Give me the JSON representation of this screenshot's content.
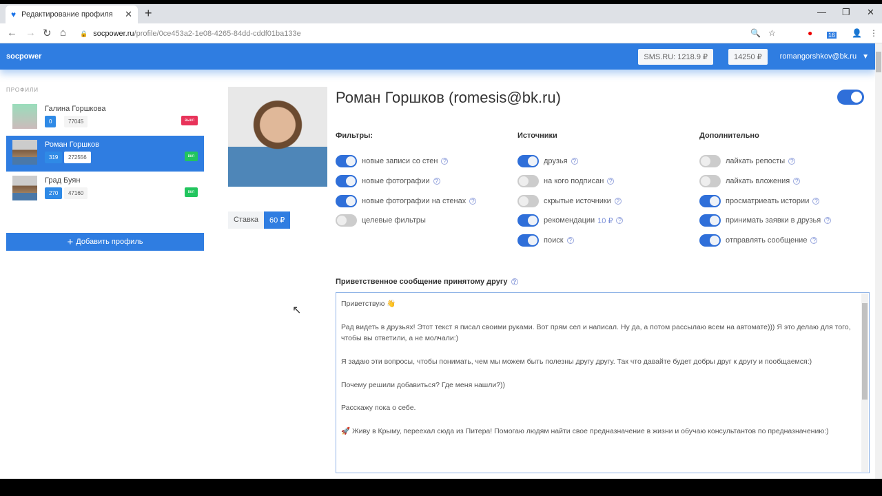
{
  "browser": {
    "tab_title": "Редактирование профиля",
    "url_host": "socpower.ru",
    "url_path": "/profile/0ce453a2-1e08-4265-84dd-cddf01ba133e",
    "ext_badge": "16"
  },
  "header": {
    "logo": "socpower",
    "sms_balance": "SMS.RU: 1218.9 ₽",
    "balance": "14250 ₽",
    "user": "romangorshkov@bk.ru"
  },
  "sidebar": {
    "label": "ПРОФИЛИ",
    "add_button": "Добавить профиль",
    "profiles": [
      {
        "name": "Галина Горшкова",
        "count1": "0",
        "count2": "77045",
        "status": "выкл",
        "status_color": "#e8335a"
      },
      {
        "name": "Роман Горшков",
        "count1": "319",
        "count2": "272556",
        "status": "вкл",
        "status_color": "#22c55e"
      },
      {
        "name": "Град Буян",
        "count1": "270",
        "count2": "47160",
        "status": "вкл",
        "status_color": "#22c55e"
      }
    ]
  },
  "profile": {
    "title": "Роман Горшков (romesis@bk.ru)",
    "enabled": true,
    "rate_label": "Ставка",
    "rate_value": "60 ₽"
  },
  "columns": [
    {
      "title": "Фильтры:",
      "items": [
        {
          "label": "новые записи со стен",
          "on": true,
          "help": true
        },
        {
          "label": "новые фотографии",
          "on": true,
          "help": true
        },
        {
          "label": "новые фотографии на стенах",
          "on": true,
          "help": true
        },
        {
          "label": "целевые фильтры",
          "on": false,
          "help": false
        }
      ]
    },
    {
      "title": "Источники",
      "items": [
        {
          "label": "друзья",
          "on": true,
          "help": true
        },
        {
          "label": "на кого подписан",
          "on": false,
          "help": true
        },
        {
          "label": "скрытые источники",
          "on": false,
          "help": true
        },
        {
          "label": "рекомендации",
          "price": "10 ₽",
          "on": true,
          "help": true
        },
        {
          "label": "поиск",
          "on": true,
          "help": true
        }
      ]
    },
    {
      "title": "Дополнительно",
      "items": [
        {
          "label": "лайкать репосты",
          "on": false,
          "help": true
        },
        {
          "label": "лайкать вложения",
          "on": false,
          "help": true
        },
        {
          "label": "просматриеать истории",
          "on": true,
          "help": true
        },
        {
          "label": "принимать заявки в друзья",
          "on": true,
          "help": true
        },
        {
          "label": "отправлять сообщение",
          "on": true,
          "help": true
        }
      ]
    }
  ],
  "message": {
    "label": "Приветственное сообщение принятому другу",
    "text": "Приветствую 👋\n\nРад видеть в друзьях! Этот текст я писал своими руками. Вот прям сел и написал. Ну да, а потом рассылаю всем на автомате))) Я это делаю для того, чтобы вы ответили, а не молчали:)\n\nЯ задаю эти вопросы, чтобы понимать, чем мы можем быть полезны другу другу. Так что давайте будет добры друг к другу и пообщаемся:)\n\nПочему решили добавиться? Где меня нашли?))\n\nРасскажу пока о себе.\n\n🚀 Живу в Крыму, переехал сюда из Питера! Помогаю людям найти свое предназначение в жизни и обучаю консультантов по предназначению:)"
  }
}
